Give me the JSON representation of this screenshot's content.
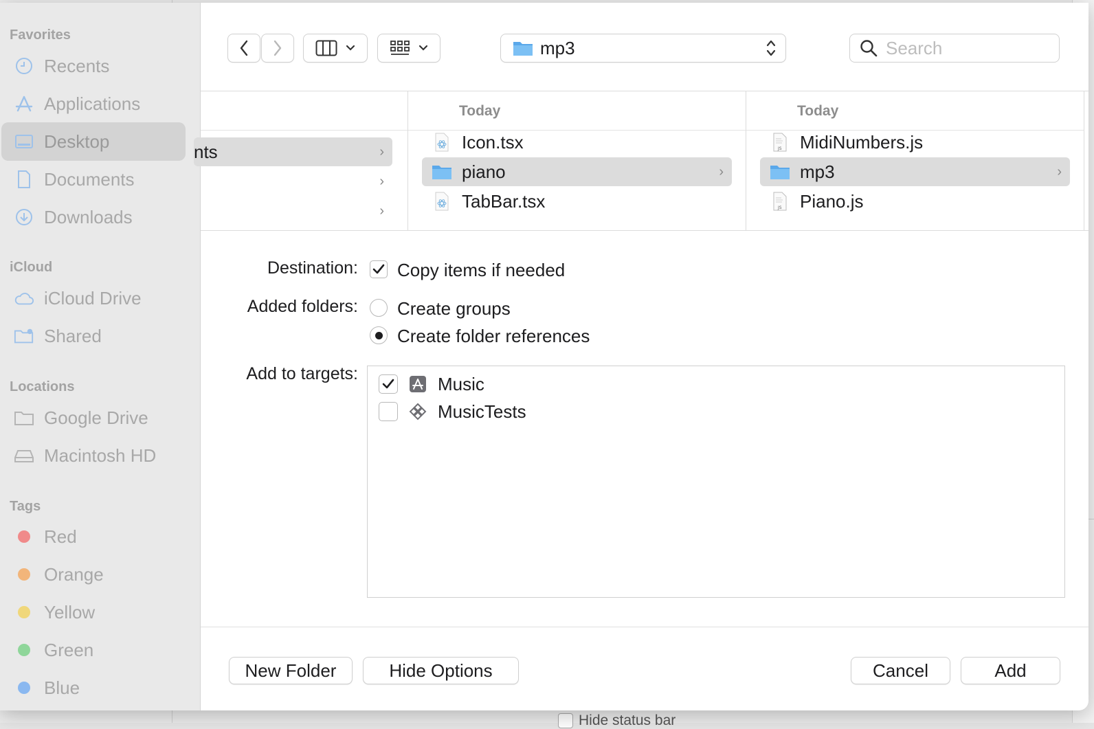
{
  "background": {
    "status_checkbox_label": "Hide status bar"
  },
  "sidebar": {
    "sections": [
      {
        "title": "Favorites"
      },
      {
        "title": "iCloud"
      },
      {
        "title": "Locations"
      },
      {
        "title": "Tags"
      }
    ],
    "favorites": [
      {
        "label": "Recents",
        "icon": "clock-icon"
      },
      {
        "label": "Applications",
        "icon": "applications-icon"
      },
      {
        "label": "Desktop",
        "icon": "desktop-icon",
        "selected": true
      },
      {
        "label": "Documents",
        "icon": "document-icon"
      },
      {
        "label": "Downloads",
        "icon": "download-icon"
      }
    ],
    "icloud": [
      {
        "label": "iCloud Drive",
        "icon": "cloud-icon"
      },
      {
        "label": "Shared",
        "icon": "shared-folder-icon"
      }
    ],
    "locations": [
      {
        "label": "Google Drive",
        "icon": "folder-icon"
      },
      {
        "label": "Macintosh HD",
        "icon": "disk-icon"
      }
    ],
    "tags": [
      {
        "label": "Red",
        "color": "#f08a8a"
      },
      {
        "label": "Orange",
        "color": "#f2b57a"
      },
      {
        "label": "Yellow",
        "color": "#f0d77a"
      },
      {
        "label": "Green",
        "color": "#8fd69a"
      },
      {
        "label": "Blue",
        "color": "#8ab8f0"
      }
    ]
  },
  "toolbar": {
    "path_label": "mp3",
    "search_placeholder": "Search"
  },
  "browser": {
    "col1": {
      "rows": [
        {
          "name": "nts",
          "selected": true,
          "has_children": true
        },
        {
          "name": "",
          "has_children": true
        },
        {
          "name": "",
          "has_children": true
        }
      ]
    },
    "col2": {
      "header": "Today",
      "rows": [
        {
          "name": "Icon.tsx",
          "type": "react-file-icon"
        },
        {
          "name": "piano",
          "type": "folder-icon",
          "selected": true,
          "has_children": true
        },
        {
          "name": "TabBar.tsx",
          "type": "react-file-icon"
        }
      ]
    },
    "col3": {
      "header": "Today",
      "rows": [
        {
          "name": "MidiNumbers.js",
          "type": "js-file-icon"
        },
        {
          "name": "mp3",
          "type": "folder-icon",
          "selected": true,
          "has_children": true
        },
        {
          "name": "Piano.js",
          "type": "js-file-icon"
        }
      ]
    }
  },
  "options": {
    "destination_label": "Destination:",
    "copy_items_label": "Copy items if needed",
    "copy_items_checked": true,
    "added_folders_label": "Added folders:",
    "create_groups_label": "Create groups",
    "create_folder_refs_label": "Create folder references",
    "selected_added_folders": "create_folder_references",
    "targets_label": "Add to targets:",
    "targets": [
      {
        "name": "Music",
        "checked": true,
        "icon": "app-target-icon"
      },
      {
        "name": "MusicTests",
        "checked": false,
        "icon": "test-target-icon"
      }
    ]
  },
  "buttons": {
    "new_folder": "New Folder",
    "hide_options": "Hide Options",
    "cancel": "Cancel",
    "add": "Add"
  },
  "colors": {
    "folder_blue": "#6cb4ee",
    "selection_gray": "#dcdcdc"
  }
}
